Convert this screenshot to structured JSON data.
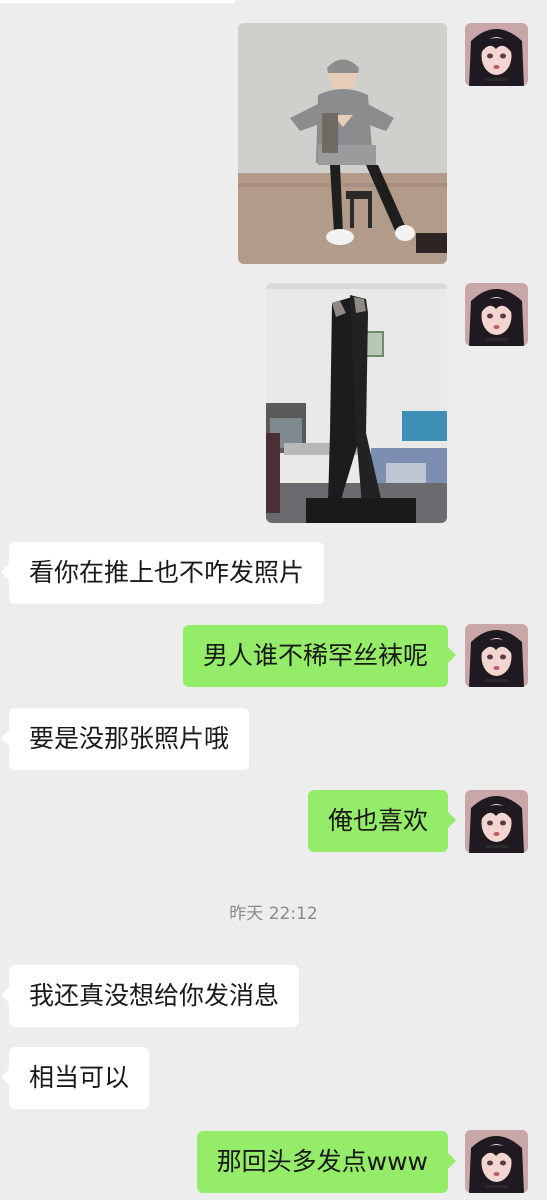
{
  "timestamp": "昨天 22:12",
  "messages": [
    {
      "side": "right",
      "type": "image",
      "alt": "selfie-sitting"
    },
    {
      "side": "right",
      "type": "image",
      "alt": "legs-up"
    },
    {
      "side": "left",
      "type": "text",
      "text": "看你在推上也不咋发照片"
    },
    {
      "side": "right",
      "type": "text",
      "text": "男人谁不稀罕丝袜呢"
    },
    {
      "side": "left",
      "type": "text",
      "text": "要是没那张照片哦"
    },
    {
      "side": "right",
      "type": "text",
      "text": "俺也喜欢"
    },
    {
      "side": "left",
      "type": "text",
      "text": "我还真没想给你发消息"
    },
    {
      "side": "left",
      "type": "text",
      "text": "相当可以"
    },
    {
      "side": "right",
      "type": "text",
      "text": "那回头多发点www"
    }
  ],
  "colors": {
    "background": "#ededed",
    "sent_bubble": "#95ec69",
    "received_bubble": "#ffffff",
    "timestamp_text": "#8a8a8a"
  },
  "icons": {
    "avatar": "anime-girl-avatar"
  }
}
